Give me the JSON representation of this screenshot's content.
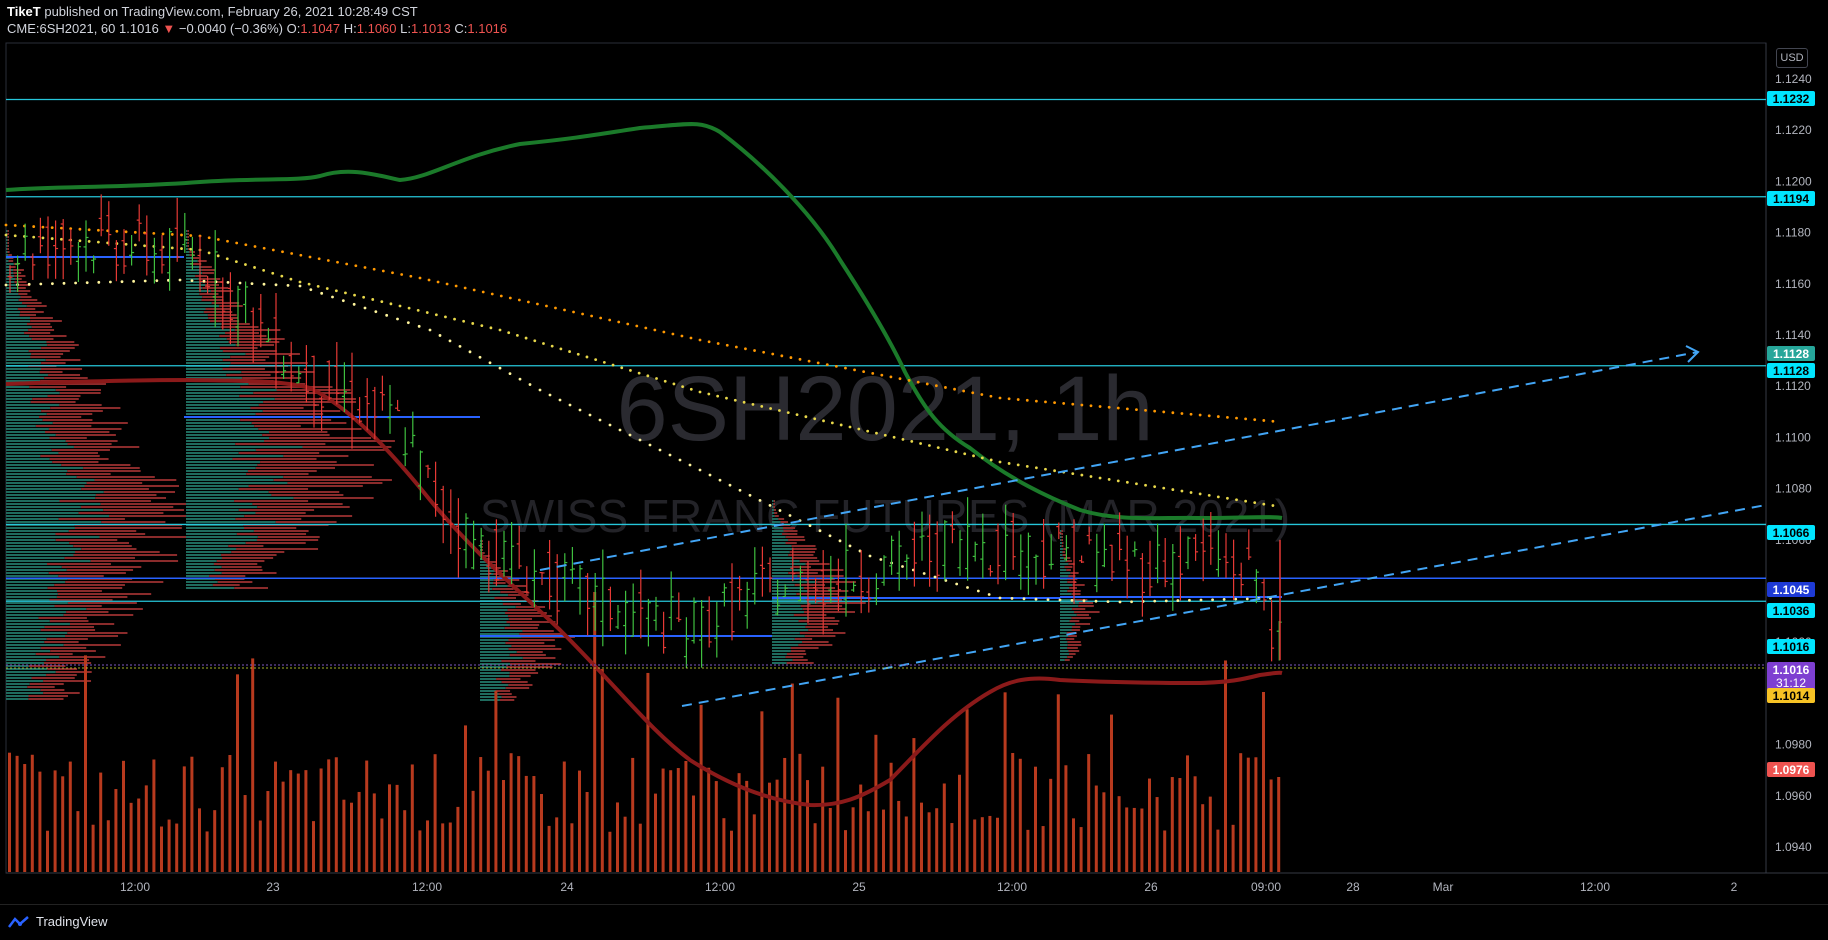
{
  "header": {
    "author": "TikeT",
    "published_text": "published on TradingView.com, February 26, 2021 10:28:49 CST",
    "symbol": "CME:6SH2021, 60",
    "last": "1.1016",
    "change": "−0.0040 (−0.36%)",
    "open_label": "O:",
    "open": "1.1047",
    "high_label": "H:",
    "high": "1.1060",
    "low_label": "L:",
    "low": "1.1013",
    "close_label": "C:",
    "close": "1.1016"
  },
  "currency_button": "USD",
  "watermark": {
    "title": "6SH2021, 1h",
    "subtitle": "SWISS FRANC FUTURES (MAR 2021)"
  },
  "footer": {
    "brand": "TradingView"
  },
  "colors": {
    "background": "#000000",
    "cyan_level": "#26c6da",
    "blue_level": "#2962ff",
    "bull": "#26a69a",
    "bear": "#ef5350",
    "green_ma": "#1b7a2a",
    "red_ma": "#8b1a1a",
    "orange_dots": "#ff9800",
    "yellow_dots": "#ffeb3b",
    "trend_dash": "#42a5f5"
  },
  "chart_data": {
    "type": "candlestick",
    "interval": "60",
    "y_range": [
      1.0935,
      1.1252
    ],
    "y_ticks": [
      "1.1240",
      "1.1220",
      "1.1200",
      "1.1180",
      "1.1160",
      "1.1140",
      "1.1120",
      "1.1100",
      "1.1080",
      "1.1060",
      "1.1040",
      "1.1020",
      "1.1000",
      "1.0980",
      "1.0960",
      "1.0940"
    ],
    "x_ticks": [
      "12:00",
      "23",
      "12:00",
      "24",
      "12:00",
      "25",
      "12:00",
      "26",
      "09:00",
      "28",
      "Mar",
      "12:00",
      "2"
    ],
    "price_labels": [
      {
        "text": "1.1232",
        "kind": "cyan"
      },
      {
        "text": "1.1194",
        "kind": "cyan"
      },
      {
        "text": "1.1128",
        "kind": "teal"
      },
      {
        "text": "1.1128",
        "kind": "cyan"
      },
      {
        "text": "1.1066",
        "kind": "cyan"
      },
      {
        "text": "1.1045",
        "kind": "blue"
      },
      {
        "text": "1.1036",
        "kind": "cyan"
      },
      {
        "text": "1.1016",
        "kind": "cyan"
      },
      {
        "text": "1.1016",
        "kind": "purple",
        "sub": "31:12"
      },
      {
        "text": "1.1014",
        "kind": "yellow"
      },
      {
        "text": "1.0976",
        "kind": "red"
      }
    ],
    "horizontal_levels": {
      "cyan": [
        1.1232,
        1.1194,
        1.1128,
        1.1066,
        1.1036
      ],
      "blue": [
        1.1045
      ]
    },
    "candles_summary": "Hourly SWISS FRANC futures from Feb 22 to Feb 26, 2021, declining from ~1.1180 to ~1.1016"
  }
}
